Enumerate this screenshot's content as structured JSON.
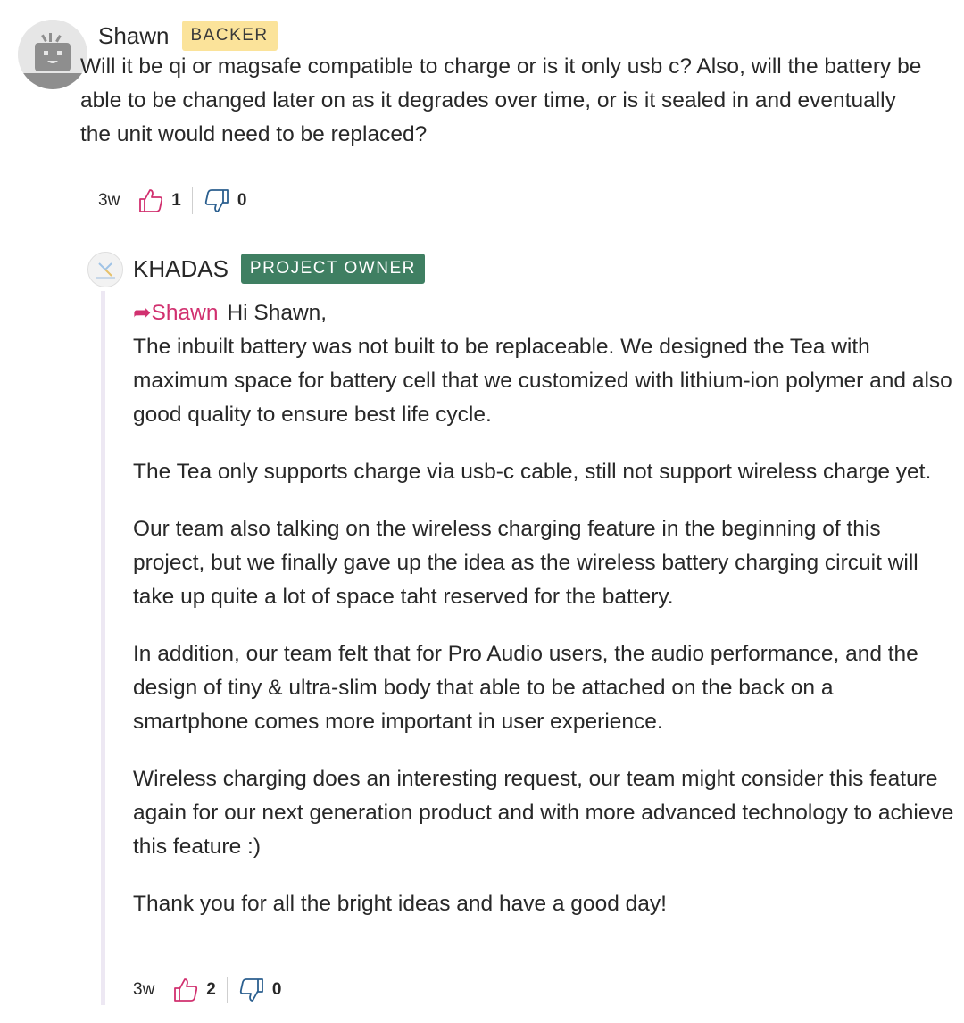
{
  "comment": {
    "author": "Shawn",
    "badge": "BACKER",
    "text": "Will it be qi or magsafe compatible to charge or is it only usb c? Also, will the battery be able to be changed later on as it degrades over time, or is it sealed in and eventually the unit would need to be replaced?",
    "time": "3w",
    "likes": "1",
    "dislikes": "0"
  },
  "reply": {
    "author": "KHADAS",
    "badge": "PROJECT OWNER",
    "mention": "➦Shawn",
    "greeting": "Hi Shawn,",
    "paragraphs": [
      "The inbuilt battery was not built to be replaceable. We designed the Tea with maximum space for battery cell that we customized with lithium-ion polymer and also good quality to ensure best life cycle.",
      "The Tea only supports charge via usb-c cable, still not support wireless charge yet.",
      "Our team also talking on the wireless charging feature in the beginning of this project, but we finally gave up the idea as the wireless battery charging circuit will take up quite a lot of space taht reserved for the battery.",
      "In addition, our team felt that for Pro Audio users, the audio performance, and the design of tiny & ultra-slim body that able to be attached on the back on a smartphone comes more important in user experience.",
      "Wireless charging does an interesting request, our team might consider this feature again for our next generation product and with more advanced technology to achieve this feature :)",
      "Thank you for all the bright ideas and have a good day!"
    ],
    "time": "3w",
    "likes": "2",
    "dislikes": "0"
  },
  "colors": {
    "like_icon": "#d1306f",
    "dislike_icon": "#2b5f8f",
    "backer_badge": "#fbe39a",
    "owner_badge": "#3f7f62",
    "mention": "#d1306f",
    "thread_line": "#ede8f3"
  }
}
